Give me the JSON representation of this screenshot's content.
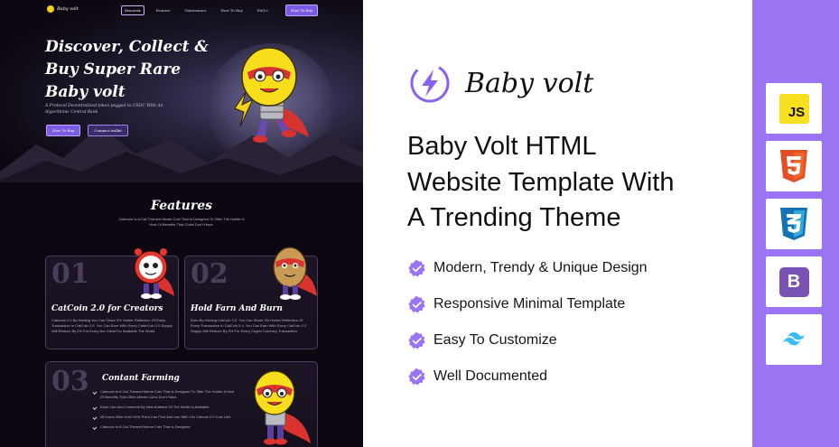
{
  "preview": {
    "nav": {
      "logo_text": "Baby volt",
      "links": [
        "Discover",
        "Feature",
        "Tokenomics",
        "How To Buy",
        "FAQ's"
      ],
      "button": "How To Buy"
    },
    "hero": {
      "title": "Discover, Collect &\nBuy Super Rare\nBaby volt",
      "subtitle": "A Protocol Decentralized token pegged to USDC With An Algorithmic Central Bank",
      "buttons": [
        "How To Buy",
        "Connect wallet"
      ]
    },
    "features": {
      "title": "Features",
      "description": "Catecoin Is A Cat-Themed Meme Coin That Is Designed To Offer The Holder A Host Of Benefits That Coins Don't Have.",
      "cards": [
        {
          "number": "01",
          "title": "CatCoin 2.0 for Creators",
          "text": "Catecoin 2.0 By Holding You Can Share 3% Holder Reflection Of Every Transaction In CatCoin 2.0. You Can Earn With Every CatteCoin 2.0 Supply Will Reduce By 2% For Every Are Great For Available The World."
        },
        {
          "number": "02",
          "title": "Hold Farn And Burn",
          "text": "Earn By Holding CatCoin 2.0. You Can Share 3% Holder Reflection Of Every Transaction In CatCoin 2.0. You Can Earn With Every CatCoin 2.0 Supply Will Reduce By 2% For Every Crypto Currency Transaction."
        },
        {
          "number": "03",
          "title": "Contant Farming",
          "items": [
            "Catecoin Is A Cat-Themed Meme Coin That Is Designed To Offer The Holder A Host Of Benefits That Other Meme Coins Don't Have.",
            "Each Like And Comment By New Address Of The World Is Available.",
            "All Users Who Hold 100k Point Can Post And Use With 10x Catcoin 2.0 Coin Like",
            "Catecoin Is A Cat-Themed Meme Coin That Is Designed."
          ]
        }
      ]
    }
  },
  "info": {
    "brand_name": "Baby volt",
    "headline": "Baby Volt HTML\nWebsite Template With\nA Trending Theme",
    "features": [
      "Modern, Trendy & Unique Design",
      "Responsive Minimal Template",
      "Easy To Customize",
      "Well Documented"
    ],
    "accent_color": "#9b74f4"
  },
  "tech_stack": [
    {
      "name": "JavaScript",
      "label": "JS",
      "icon": "js-icon",
      "color": "#f7df1e"
    },
    {
      "name": "HTML5",
      "label": "5",
      "icon": "html5-icon",
      "color": "#e44d26"
    },
    {
      "name": "CSS3",
      "label": "3",
      "icon": "css3-icon",
      "color": "#1b73ba"
    },
    {
      "name": "Bootstrap",
      "label": "B",
      "icon": "bootstrap-icon",
      "color": "#7952b3"
    },
    {
      "name": "Tailwind CSS",
      "label": "",
      "icon": "tailwind-icon",
      "color": "#38bdf8"
    }
  ]
}
